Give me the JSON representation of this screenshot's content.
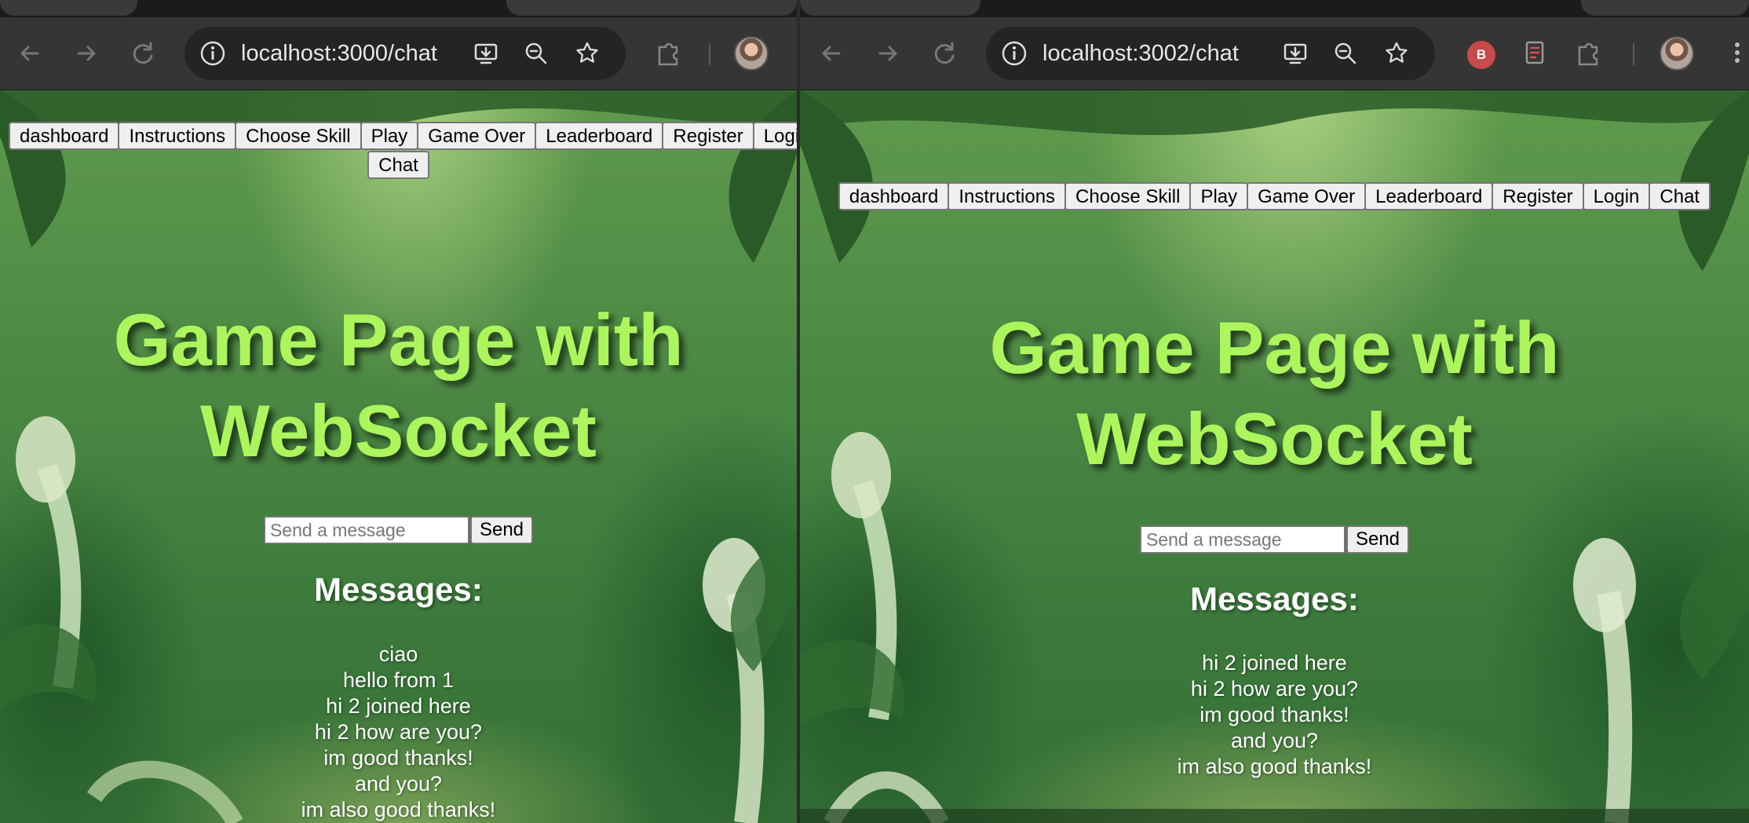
{
  "left": {
    "url": "localhost:3000/chat",
    "nav": [
      "dashboard",
      "Instructions",
      "Choose Skill",
      "Play",
      "Game Over",
      "Leaderboard",
      "Register",
      "Login",
      "Chat"
    ],
    "heading_line1": "Game Page with",
    "heading_line2": "WebSocket",
    "input_placeholder": "Send a message",
    "send_label": "Send",
    "messages_heading": "Messages:",
    "messages": [
      "ciao",
      "hello from 1",
      "hi 2 joined here",
      "hi 2 how are you?",
      "im good thanks!",
      "and you?",
      "im also good thanks!"
    ]
  },
  "right": {
    "url": "localhost:3002/chat",
    "nav": [
      "dashboard",
      "Instructions",
      "Choose Skill",
      "Play",
      "Game Over",
      "Leaderboard",
      "Register",
      "Login",
      "Chat"
    ],
    "heading_line1": "Game Page with",
    "heading_line2": "WebSocket",
    "input_placeholder": "Send a message",
    "send_label": "Send",
    "messages_heading": "Messages:",
    "messages": [
      "hi 2 joined here",
      "hi 2 how are you?",
      "im good thanks!",
      "and you?",
      "im also good thanks!"
    ]
  },
  "icons": {
    "back": "arrow-left-icon",
    "forward": "arrow-right-icon",
    "reload": "reload-icon",
    "site_info": "info-icon",
    "install": "install-app-icon",
    "zoom": "zoom-icon",
    "bookmark": "star-icon",
    "extensions": "puzzle-icon",
    "profile": "avatar"
  },
  "colors": {
    "heading": "#adf55c",
    "chrome_bg": "#353535",
    "omnibox_bg": "#242424"
  }
}
